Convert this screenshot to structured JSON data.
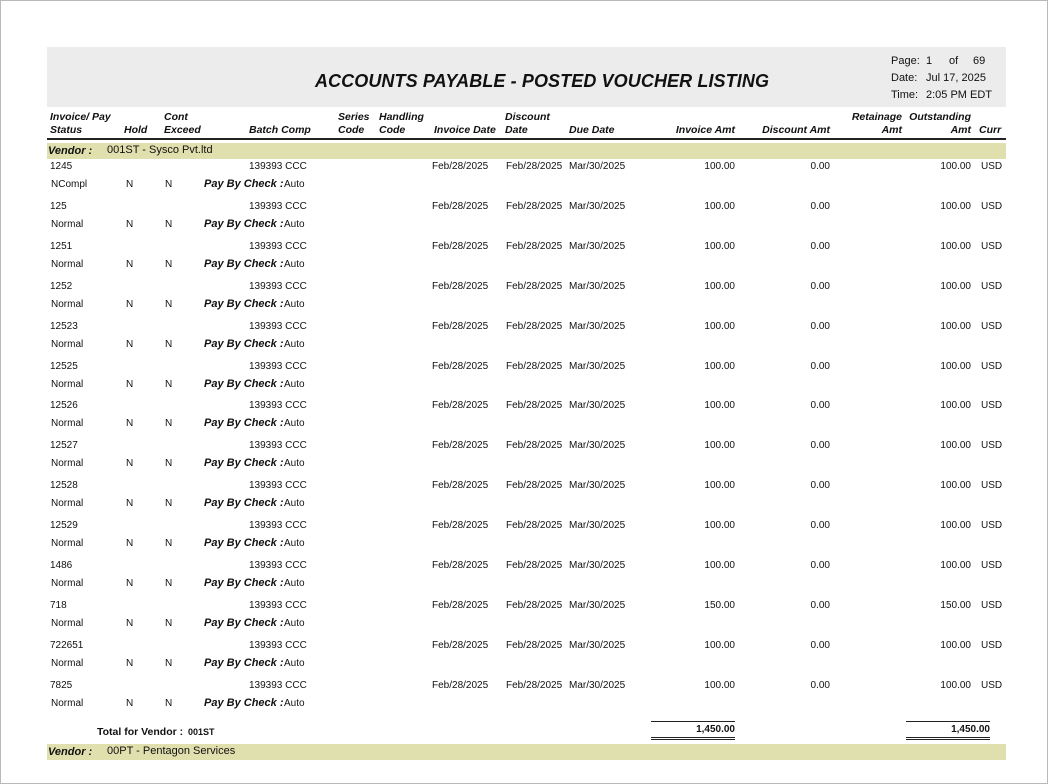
{
  "report": {
    "title": "ACCOUNTS PAYABLE - POSTED VOUCHER LISTING",
    "page_label": "Page:",
    "page_value": "1",
    "of_label": "of",
    "of_value": "69",
    "date_label": "Date:",
    "date_value": "Jul 17, 2025",
    "time_label": "Time:",
    "time_value": "2:05 PM EDT"
  },
  "columns": {
    "invoice_pay": "Invoice/ Pay",
    "status": "Status",
    "hold": "Hold",
    "cont": "Cont",
    "exceed": "Exceed",
    "batch_comp": "Batch Comp",
    "series": "Series",
    "code1": "Code",
    "handling": "Handling",
    "code2": "Code",
    "invoice_date": "Invoice Date",
    "discount": "Discount",
    "date": "Date",
    "due_date": "Due Date",
    "invoice_amt": "Invoice Amt",
    "discount_amt": "Discount Amt",
    "retainage": "Retainage",
    "amt1": "Amt",
    "outstanding": "Outstanding",
    "amt2": "Amt",
    "curr": "Curr"
  },
  "vendor_label": "Vendor :",
  "pay_by_check_label": "Pay By Check :",
  "vendors": [
    {
      "name": "001ST - Sysco Pvt.ltd",
      "total_label": "Total for Vendor :",
      "total_code": "001ST",
      "total_invoice_amt": "1,450.00",
      "total_outstanding_amt": "1,450.00"
    },
    {
      "name": "00PT - Pentagon Services"
    }
  ],
  "records": [
    {
      "invoice": "1245",
      "status": "NCompl",
      "hold": "N",
      "cont": "N",
      "pay_method": "Auto",
      "batch": "139393 CCC",
      "invoice_date": "Feb/28/2025",
      "discount_date": "Feb/28/2025",
      "due_date": "Mar/30/2025",
      "invoice_amt": "100.00",
      "discount_amt": "0.00",
      "outstanding_amt": "100.00",
      "curr": "USD"
    },
    {
      "invoice": "125",
      "status": "Normal",
      "hold": "N",
      "cont": "N",
      "pay_method": "Auto",
      "batch": "139393 CCC",
      "invoice_date": "Feb/28/2025",
      "discount_date": "Feb/28/2025",
      "due_date": "Mar/30/2025",
      "invoice_amt": "100.00",
      "discount_amt": "0.00",
      "outstanding_amt": "100.00",
      "curr": "USD"
    },
    {
      "invoice": "1251",
      "status": "Normal",
      "hold": "N",
      "cont": "N",
      "pay_method": "Auto",
      "batch": "139393 CCC",
      "invoice_date": "Feb/28/2025",
      "discount_date": "Feb/28/2025",
      "due_date": "Mar/30/2025",
      "invoice_amt": "100.00",
      "discount_amt": "0.00",
      "outstanding_amt": "100.00",
      "curr": "USD"
    },
    {
      "invoice": "1252",
      "status": "Normal",
      "hold": "N",
      "cont": "N",
      "pay_method": "Auto",
      "batch": "139393 CCC",
      "invoice_date": "Feb/28/2025",
      "discount_date": "Feb/28/2025",
      "due_date": "Mar/30/2025",
      "invoice_amt": "100.00",
      "discount_amt": "0.00",
      "outstanding_amt": "100.00",
      "curr": "USD"
    },
    {
      "invoice": "12523",
      "status": "Normal",
      "hold": "N",
      "cont": "N",
      "pay_method": "Auto",
      "batch": "139393 CCC",
      "invoice_date": "Feb/28/2025",
      "discount_date": "Feb/28/2025",
      "due_date": "Mar/30/2025",
      "invoice_amt": "100.00",
      "discount_amt": "0.00",
      "outstanding_amt": "100.00",
      "curr": "USD"
    },
    {
      "invoice": "12525",
      "status": "Normal",
      "hold": "N",
      "cont": "N",
      "pay_method": "Auto",
      "batch": "139393 CCC",
      "invoice_date": "Feb/28/2025",
      "discount_date": "Feb/28/2025",
      "due_date": "Mar/30/2025",
      "invoice_amt": "100.00",
      "discount_amt": "0.00",
      "outstanding_amt": "100.00",
      "curr": "USD"
    },
    {
      "invoice": "12526",
      "status": "Normal",
      "hold": "N",
      "cont": "N",
      "pay_method": "Auto",
      "batch": "139393 CCC",
      "invoice_date": "Feb/28/2025",
      "discount_date": "Feb/28/2025",
      "due_date": "Mar/30/2025",
      "invoice_amt": "100.00",
      "discount_amt": "0.00",
      "outstanding_amt": "100.00",
      "curr": "USD"
    },
    {
      "invoice": "12527",
      "status": "Normal",
      "hold": "N",
      "cont": "N",
      "pay_method": "Auto",
      "batch": "139393 CCC",
      "invoice_date": "Feb/28/2025",
      "discount_date": "Feb/28/2025",
      "due_date": "Mar/30/2025",
      "invoice_amt": "100.00",
      "discount_amt": "0.00",
      "outstanding_amt": "100.00",
      "curr": "USD"
    },
    {
      "invoice": "12528",
      "status": "Normal",
      "hold": "N",
      "cont": "N",
      "pay_method": "Auto",
      "batch": "139393 CCC",
      "invoice_date": "Feb/28/2025",
      "discount_date": "Feb/28/2025",
      "due_date": "Mar/30/2025",
      "invoice_amt": "100.00",
      "discount_amt": "0.00",
      "outstanding_amt": "100.00",
      "curr": "USD"
    },
    {
      "invoice": "12529",
      "status": "Normal",
      "hold": "N",
      "cont": "N",
      "pay_method": "Auto",
      "batch": "139393 CCC",
      "invoice_date": "Feb/28/2025",
      "discount_date": "Feb/28/2025",
      "due_date": "Mar/30/2025",
      "invoice_amt": "100.00",
      "discount_amt": "0.00",
      "outstanding_amt": "100.00",
      "curr": "USD"
    },
    {
      "invoice": "1486",
      "status": "Normal",
      "hold": "N",
      "cont": "N",
      "pay_method": "Auto",
      "batch": "139393 CCC",
      "invoice_date": "Feb/28/2025",
      "discount_date": "Feb/28/2025",
      "due_date": "Mar/30/2025",
      "invoice_amt": "100.00",
      "discount_amt": "0.00",
      "outstanding_amt": "100.00",
      "curr": "USD"
    },
    {
      "invoice": "718",
      "status": "Normal",
      "hold": "N",
      "cont": "N",
      "pay_method": "Auto",
      "batch": "139393 CCC",
      "invoice_date": "Feb/28/2025",
      "discount_date": "Feb/28/2025",
      "due_date": "Mar/30/2025",
      "invoice_amt": "150.00",
      "discount_amt": "0.00",
      "outstanding_amt": "150.00",
      "curr": "USD"
    },
    {
      "invoice": "722651",
      "status": "Normal",
      "hold": "N",
      "cont": "N",
      "pay_method": "Auto",
      "batch": "139393 CCC",
      "invoice_date": "Feb/28/2025",
      "discount_date": "Feb/28/2025",
      "due_date": "Mar/30/2025",
      "invoice_amt": "100.00",
      "discount_amt": "0.00",
      "outstanding_amt": "100.00",
      "curr": "USD"
    },
    {
      "invoice": "7825",
      "status": "Normal",
      "hold": "N",
      "cont": "N",
      "pay_method": "Auto",
      "batch": "139393 CCC",
      "invoice_date": "Feb/28/2025",
      "discount_date": "Feb/28/2025",
      "due_date": "Mar/30/2025",
      "invoice_amt": "100.00",
      "discount_amt": "0.00",
      "outstanding_amt": "100.00",
      "curr": "USD"
    }
  ]
}
